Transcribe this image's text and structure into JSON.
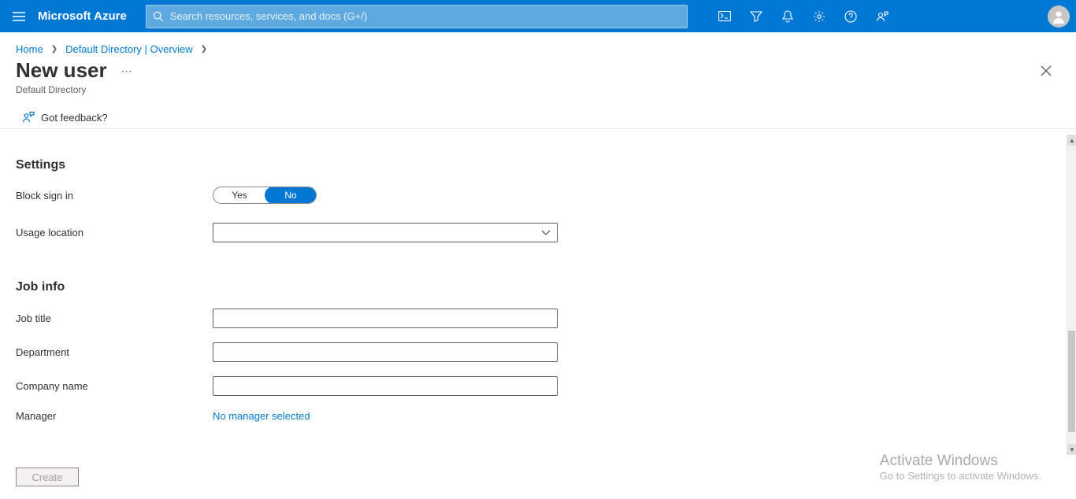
{
  "topbar": {
    "brand": "Microsoft Azure",
    "search_placeholder": "Search resources, services, and docs (G+/)"
  },
  "breadcrumb": {
    "items": [
      "Home",
      "Default Directory | Overview"
    ]
  },
  "page": {
    "title": "New user",
    "subtitle": "Default Directory",
    "feedback": "Got feedback?"
  },
  "sections": {
    "settings": {
      "heading": "Settings",
      "block_sign_in_label": "Block sign in",
      "block_sign_in_yes": "Yes",
      "block_sign_in_no": "No",
      "block_sign_in_value": "No",
      "usage_location_label": "Usage location",
      "usage_location_value": ""
    },
    "jobinfo": {
      "heading": "Job info",
      "job_title_label": "Job title",
      "job_title_value": "",
      "department_label": "Department",
      "department_value": "",
      "company_label": "Company name",
      "company_value": "",
      "manager_label": "Manager",
      "manager_value": "No manager selected"
    }
  },
  "footer": {
    "create": "Create"
  },
  "watermark": {
    "line1": "Activate Windows",
    "line2": "Go to Settings to activate Windows."
  }
}
